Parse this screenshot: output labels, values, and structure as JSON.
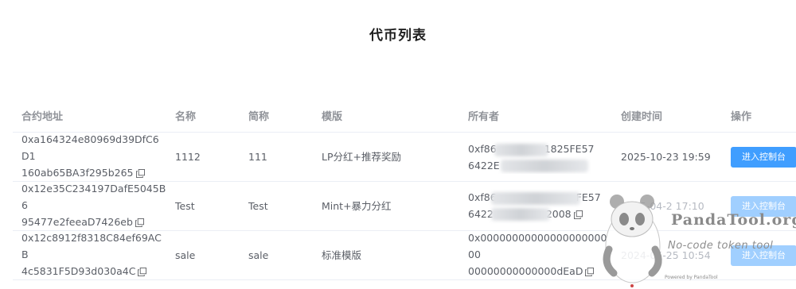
{
  "page": {
    "title": "代币列表"
  },
  "table": {
    "headers": {
      "address": "合约地址",
      "name": "名称",
      "symbol": "简称",
      "template": "模版",
      "owner": "所有者",
      "created": "创建时间",
      "action": "操作"
    },
    "rows": [
      {
        "address_line1": "0xa164324e80969d39DfC6D1",
        "address_line2": "160ab65BA3f295b265",
        "name": "1112",
        "symbol": "111",
        "template": "LP分红+推荐奖励",
        "owner_line1": "0xf86",
        "owner_line1_tail": "1825FE57",
        "owner_line2": "6422E",
        "owner_line2_tail": "",
        "created": "2025-10-23 19:59",
        "action": "进入控制台"
      },
      {
        "address_line1": "0x12e35C234197DafE5045B6",
        "address_line2": "95477e2feeaD7426eb",
        "name": "Test",
        "symbol": "Test",
        "template": "Mint+暴力分红",
        "owner_line1": "0xf86",
        "owner_line1_tail": "FE57",
        "owner_line2": "6422",
        "owner_line2_tail": "2008",
        "created": "2025-04-2 17:10",
        "action": "进入控制台"
      },
      {
        "address_line1": "0x12c8912f8318C84ef69ACB",
        "address_line2": "4c5831F5D93d030a4C",
        "name": "sale",
        "symbol": "sale",
        "template": "标准模版",
        "owner_line1": "0x0000000000000000000000",
        "owner_line1_tail": "",
        "owner_line2": "00000000000000dEaD",
        "owner_line2_tail": "",
        "created": "2024-05-25 10:54",
        "action": "进入控制台"
      }
    ]
  },
  "watermark": {
    "brand": "PandaTool.org",
    "tagline": "No-code token tool",
    "small": "Powered by PandaTool"
  },
  "colors": {
    "primary": "#409eff",
    "primary_faded": "#a0cfff",
    "border": "#ebeef5",
    "header_text": "#909399"
  }
}
